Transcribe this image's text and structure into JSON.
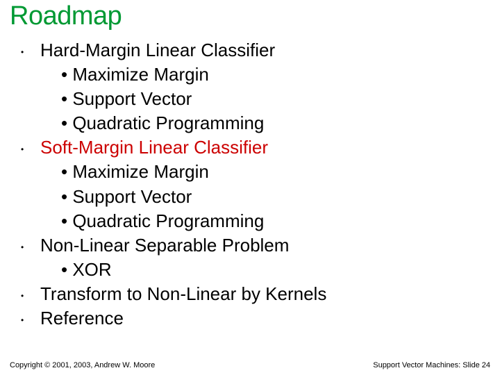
{
  "title": "Roadmap",
  "items": [
    {
      "label": "Hard-Margin Linear Classifier",
      "highlight": false,
      "sub": [
        "Maximize Margin",
        "Support Vector",
        "Quadratic Programming"
      ]
    },
    {
      "label": "Soft-Margin Linear Classifier",
      "highlight": true,
      "sub": [
        "Maximize Margin",
        "Support Vector",
        "Quadratic Programming"
      ]
    },
    {
      "label": "Non-Linear Separable Problem",
      "highlight": false,
      "sub": [
        "XOR"
      ]
    },
    {
      "label": "Transform to Non-Linear by Kernels",
      "highlight": false,
      "sub": []
    },
    {
      "label": "Reference",
      "highlight": false,
      "sub": []
    }
  ],
  "footer": {
    "left": "Copyright © 2001, 2003, Andrew W. Moore",
    "right": "Support Vector Machines: Slide 24"
  }
}
